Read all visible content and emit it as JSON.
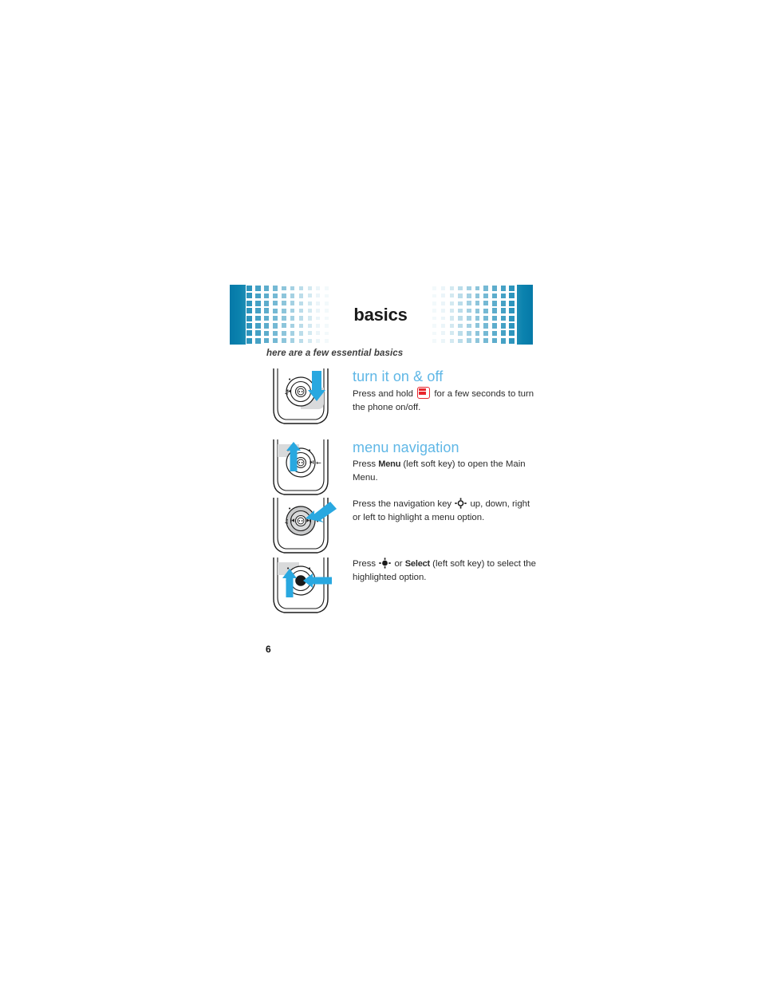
{
  "page": {
    "number": "6",
    "banner_title": "basics",
    "subtitle": "here are a few essential basics",
    "accent_blue": "#5fb7e6",
    "banner_blue": "#0579a8",
    "grid_blue": "#2d95bd",
    "key_red": "#e8262d",
    "arrow_blue": "#29a8e0"
  },
  "sections": [
    {
      "id": "turn-it-on-off",
      "heading": "turn it on & off",
      "body_parts": [
        {
          "type": "text",
          "value": "Press and hold "
        },
        {
          "type": "icon",
          "value": "pwr-end-key-icon"
        },
        {
          "type": "text",
          "value": " for a few seconds to turn the phone on/off."
        }
      ],
      "body_plain": "Press and hold  for a few seconds to turn the phone on/off.",
      "body_pre": "Press and hold",
      "body_post": "for a few seconds to turn the phone on/off.",
      "illustration": "phone-power-key-down-arrow"
    },
    {
      "id": "menu-navigation",
      "heading": "menu navigation",
      "body_pre": "Press",
      "body_bold": "Menu",
      "body_post": "(left soft key) to open the Main Menu.",
      "illustration": "phone-left-soft-key-up-arrow"
    },
    {
      "id": "navigation-key",
      "heading": "",
      "body_pre": "Press the navigation key",
      "body_post": "up, down, right or left to highlight a menu option.",
      "illustration": "phone-navigation-ring-arrow"
    },
    {
      "id": "select-key",
      "heading": "",
      "body_pre": "Press",
      "body_mid": "or",
      "body_bold": "Select",
      "body_post": "(left soft key) to select the highlighted option.",
      "illustration": "phone-center-select-two-arrows"
    }
  ]
}
